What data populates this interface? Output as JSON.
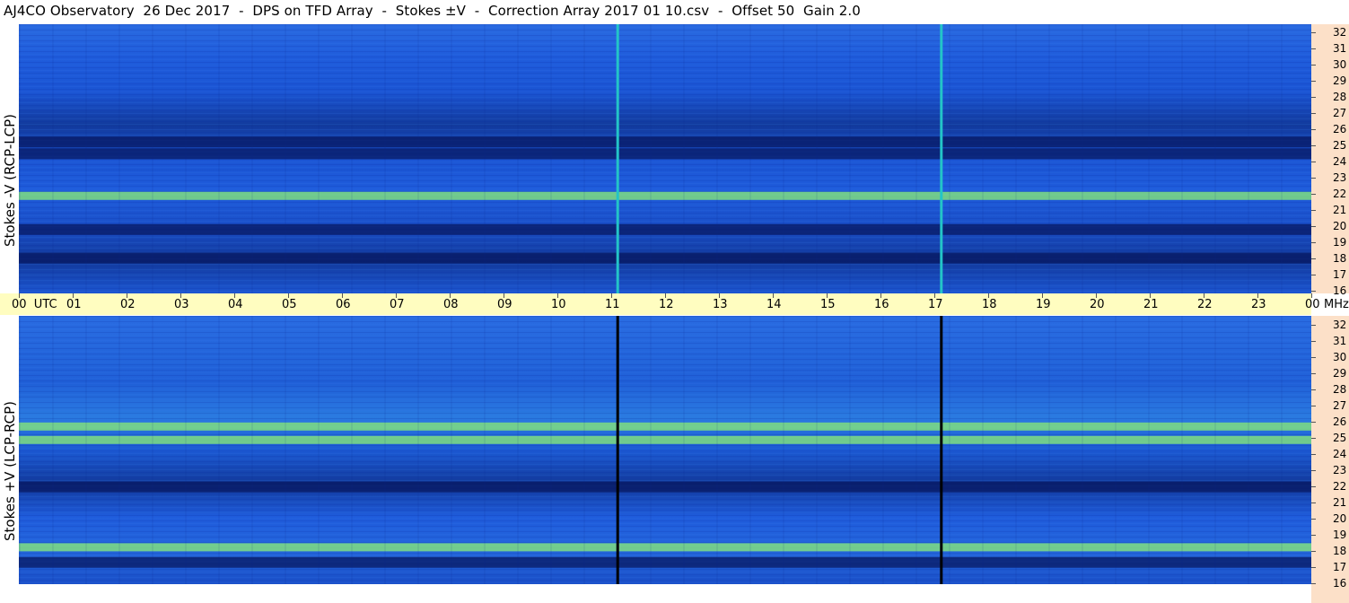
{
  "title": "AJ4CO Observatory  26 Dec 2017  -  DPS on TFD Array  -  Stokes ±V  -  Correction Array 2017 01 10.csv  -  Offset 50  Gain 2.0",
  "panels": [
    {
      "ylabel": "Stokes -V (RCP-LCP)",
      "line_color": "#23c4c8"
    },
    {
      "ylabel": "Stokes +V (LCP-RCP)",
      "line_color": "#000000"
    }
  ],
  "freq_axis": {
    "ticks": [
      "32",
      "31",
      "30",
      "29",
      "28",
      "27",
      "26",
      "25",
      "24",
      "23",
      "22",
      "21",
      "20",
      "19",
      "18",
      "17",
      "16"
    ],
    "unit": "MHz"
  },
  "time_axis": {
    "labels": [
      "00  UTC",
      "01",
      "02",
      "03",
      "04",
      "05",
      "06",
      "07",
      "08",
      "09",
      "10",
      "11",
      "12",
      "13",
      "14",
      "15",
      "16",
      "17",
      "18",
      "19",
      "20",
      "21",
      "22",
      "23",
      "00"
    ]
  },
  "colors": {
    "deep": "#0a1a70",
    "mid": "#1a5ad8",
    "bright": "#7ee87a",
    "time_bg": "#fffdc0",
    "freq_bg": "#fce0c8"
  },
  "chart_data": {
    "type": "heatmap",
    "x_unit": "UTC hour",
    "xlim": [
      0,
      24
    ],
    "y_unit": "MHz",
    "ylim": [
      16,
      32
    ],
    "series": [
      {
        "name": "Stokes -V (RCP-LCP)",
        "bands": [
          {
            "freq": 25,
            "level": "dark"
          },
          {
            "freq": 24.3,
            "level": "dark"
          },
          {
            "freq": 21.8,
            "level": "bright"
          },
          {
            "freq": 19.8,
            "level": "dark"
          },
          {
            "freq": 18.1,
            "level": "dark"
          }
        ],
        "vertical_lines_utc": [
          11.12,
          17.13
        ]
      },
      {
        "name": "Stokes +V (LCP-RCP)",
        "bands": [
          {
            "freq": 25.4,
            "level": "bright"
          },
          {
            "freq": 24.6,
            "level": "bright"
          },
          {
            "freq": 21.8,
            "level": "dark"
          },
          {
            "freq": 18.2,
            "level": "bright"
          },
          {
            "freq": 17.3,
            "level": "dark"
          }
        ],
        "vertical_lines_utc": [
          11.12,
          17.13
        ]
      }
    ]
  }
}
